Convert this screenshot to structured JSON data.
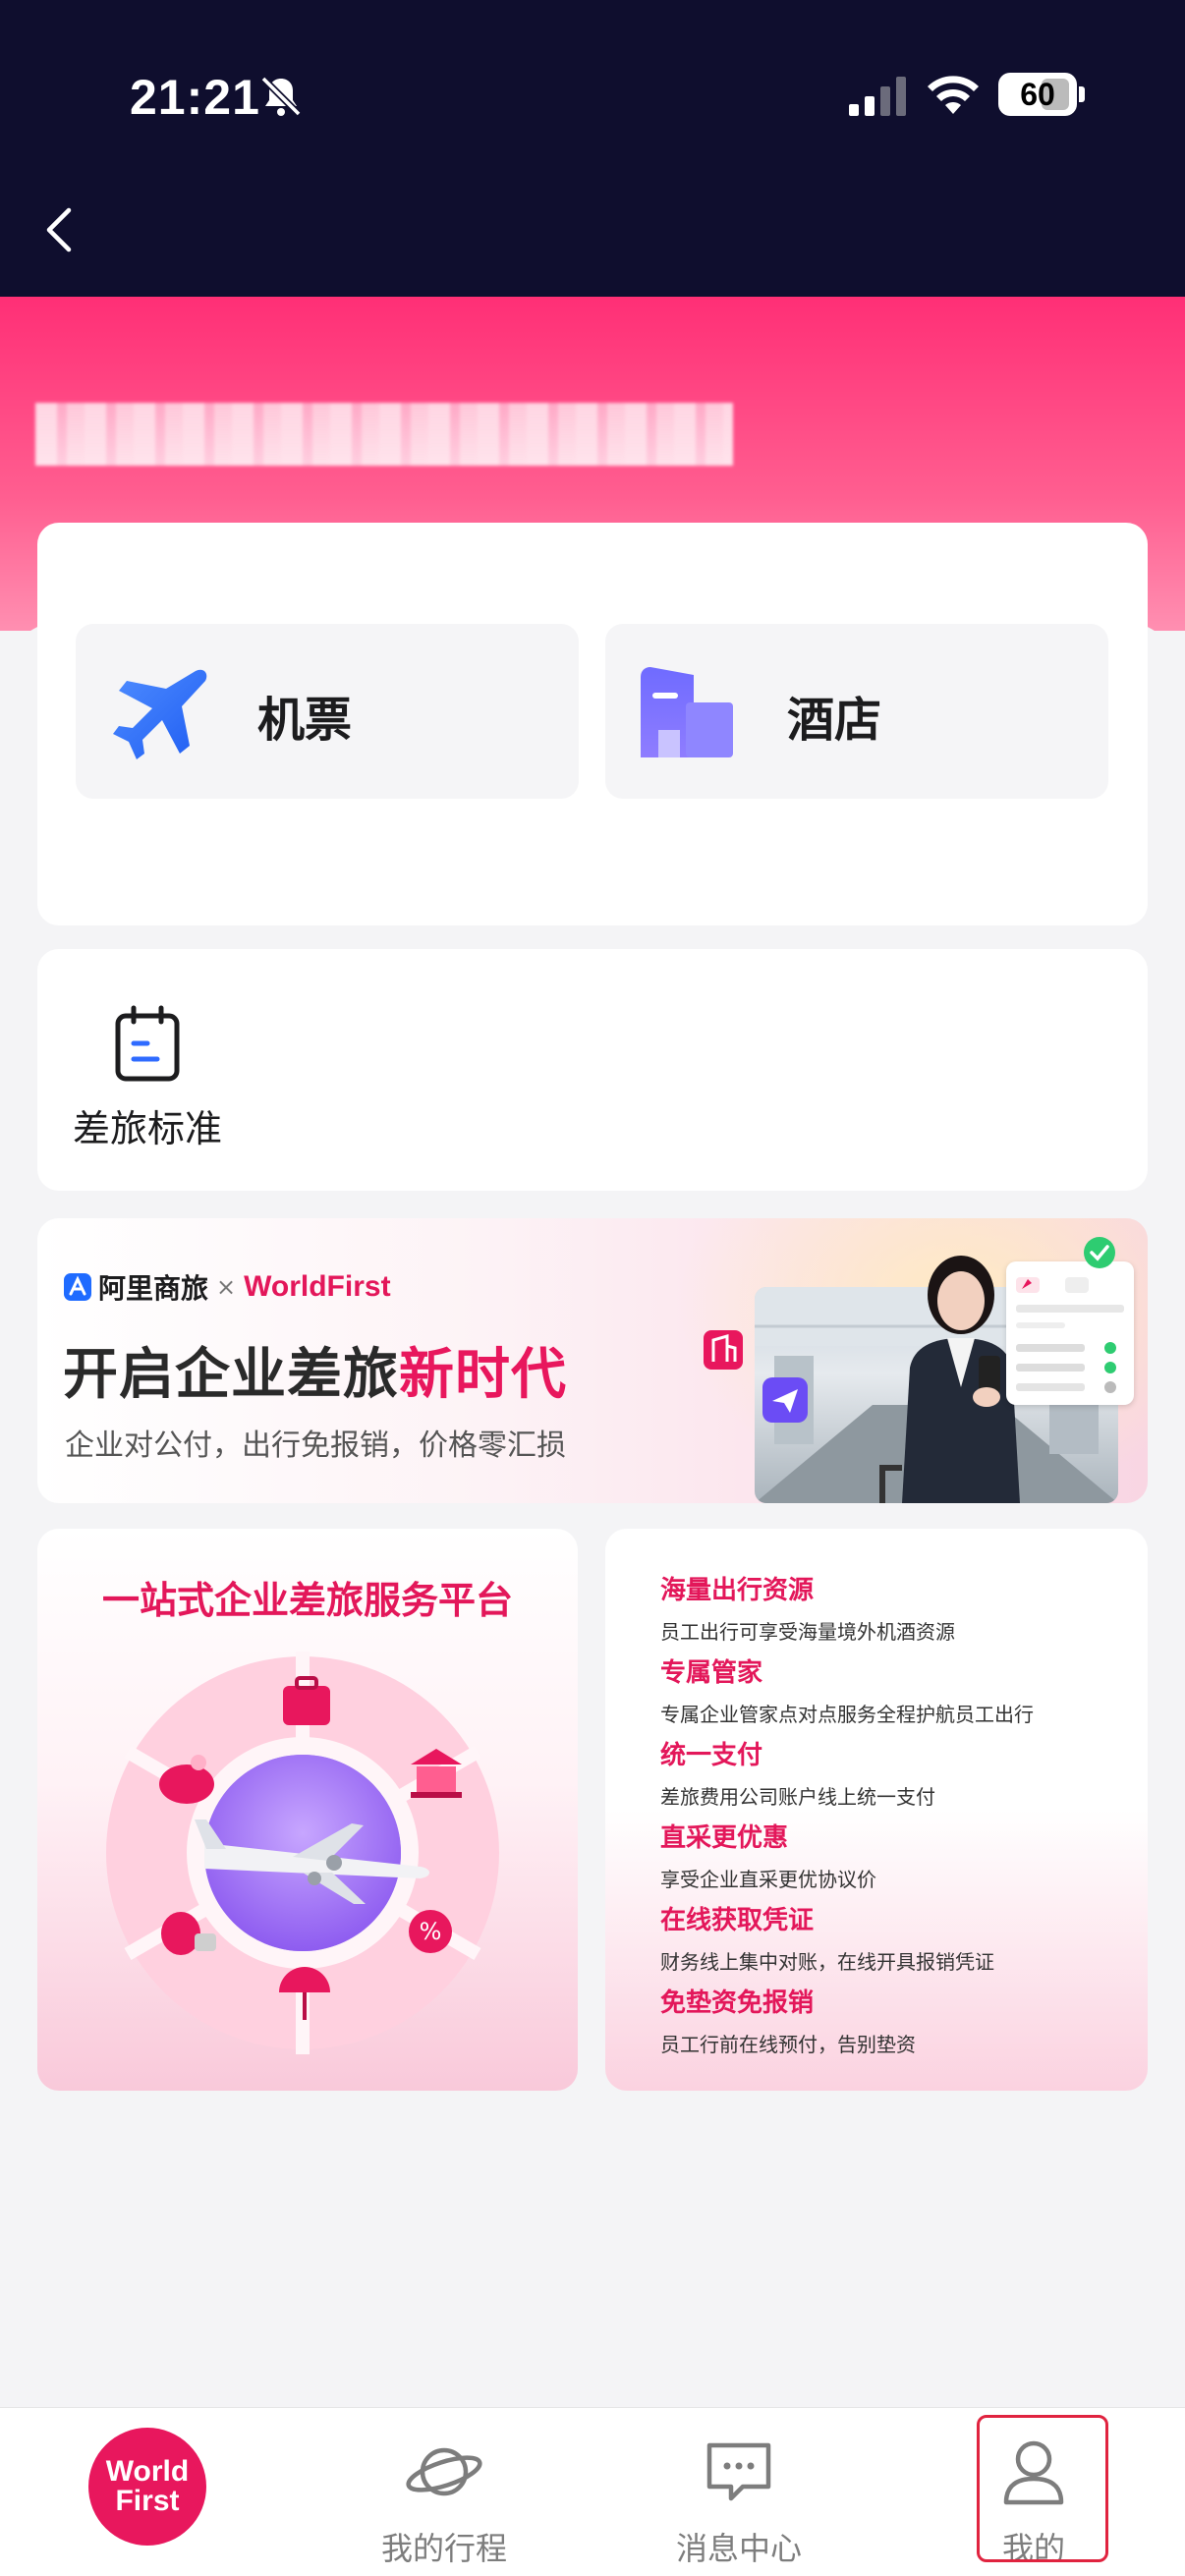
{
  "status_bar": {
    "time": "21:21",
    "battery": "60"
  },
  "header": {
    "back_icon": "chevron-left-icon"
  },
  "booking": {
    "flight_label": "机票",
    "hotel_label": "酒店"
  },
  "policy": {
    "label": "差旅标准"
  },
  "promo": {
    "brand_a": "阿里商旅",
    "brand_x": "×",
    "brand_b": "WorldFirst",
    "title_main": "开启企业差旅",
    "title_accent": "新时代",
    "subtitle": "企业对公付，出行免报销，价格零汇损"
  },
  "platform": {
    "title": "一站式企业差旅服务平台"
  },
  "features": [
    {
      "title": "海量出行资源",
      "desc": "员工出行可享受海量境外机酒资源"
    },
    {
      "title": "专属管家",
      "desc": "专属企业管家点对点服务全程护航员工出行"
    },
    {
      "title": "统一支付",
      "desc": "差旅费用公司账户线上统一支付"
    },
    {
      "title": "直采更优惠",
      "desc": "享受企业直采更优协议价"
    },
    {
      "title": "在线获取凭证",
      "desc": "财务线上集中对账，在线开具报销凭证"
    },
    {
      "title": "免垫资免报销",
      "desc": "员工行前在线预付，告别垫资"
    }
  ],
  "tabbar": {
    "home_logo_line1": "World",
    "home_logo_line2": "First",
    "trips": "我的行程",
    "messages": "消息中心",
    "mine": "我的"
  },
  "colors": {
    "accent": "#e3175a",
    "header_bg": "#0f0e2e",
    "hero_pink": "#ff2f76",
    "highlight_box": "#e0233f"
  }
}
